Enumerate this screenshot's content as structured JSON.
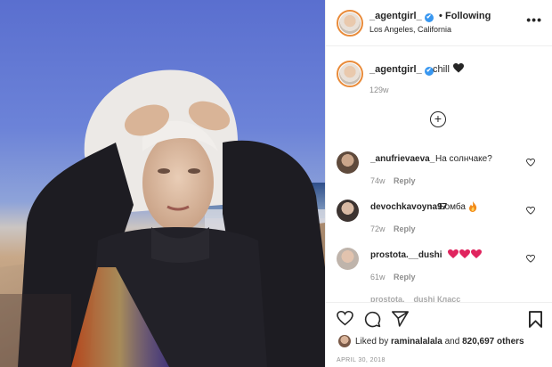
{
  "post": {
    "author": "_agentgirl_",
    "verified_mark": "✔",
    "separator": "•",
    "follow_state": "Following",
    "location": "Los Angeles, California",
    "more_glyph": "•••",
    "caption_text": "chill",
    "caption_time": "129w",
    "load_more_glyph": "+",
    "heart_color": "#262626"
  },
  "comments": [
    {
      "user": "_anufrievaeva_",
      "text": "На солнчаке?",
      "time": "74w",
      "reply": "Reply"
    },
    {
      "user": "devochkavoyna97",
      "text": "Бомба",
      "emoji": "fire-icon",
      "time": "72w",
      "reply": "Reply"
    },
    {
      "user": "prostota.__dushi",
      "emoji": "red-hearts",
      "time": "61w",
      "reply": "Reply"
    }
  ],
  "partial_comment": "prostota.__dushi Класс",
  "actions": {
    "like": "heart-outline-icon",
    "comment": "comment-bubble-icon",
    "share": "share-arrow-icon",
    "save": "bookmark-icon"
  },
  "likes": {
    "prefix": "Liked by",
    "user": "raminalalala",
    "middle": "and",
    "count": "820,697 others"
  },
  "date": "APRIL 30, 2018",
  "colors": {
    "accent_blue": "#3897f0",
    "heart_red": "#e0245e",
    "muted": "#8e8e8e",
    "ring": "#e98b3a"
  }
}
